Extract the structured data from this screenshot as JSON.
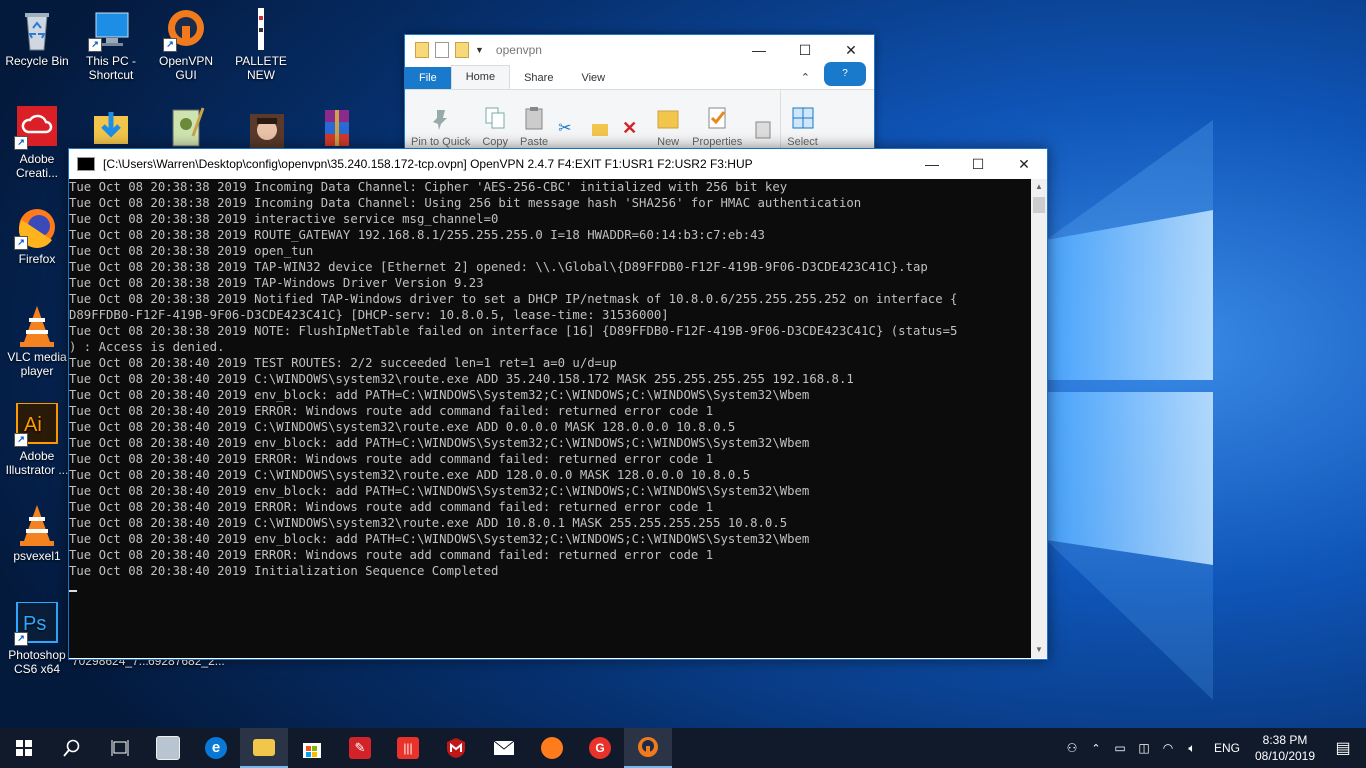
{
  "desktop": {
    "icons": [
      {
        "label": "Recycle Bin"
      },
      {
        "label": "This PC - Shortcut"
      },
      {
        "label": "OpenVPN GUI"
      },
      {
        "label": "PALLETE NEW"
      },
      {
        "label": "Adobe Creati..."
      },
      {
        "label": "Firefox"
      },
      {
        "label": "VLC media player"
      },
      {
        "label": "Adobe Illustrator ..."
      },
      {
        "label": "psvexel1"
      },
      {
        "label": "Photoshop CS6 x64"
      },
      {
        "label": "70298624_7..."
      },
      {
        "label": "69287682_2..."
      }
    ]
  },
  "explorer": {
    "title": "openvpn",
    "tabs": [
      "File",
      "Home",
      "Share",
      "View"
    ],
    "ribbon": [
      "Pin to Quick",
      "Copy",
      "Paste",
      "New",
      "Properties",
      "Select"
    ]
  },
  "console": {
    "title": "[C:\\Users\\Warren\\Desktop\\config\\openvpn\\35.240.158.172-tcp.ovpn] OpenVPN 2.4.7 F4:EXIT F1:USR1 F2:USR2 F3:HUP",
    "log": "Tue Oct 08 20:38:38 2019 Incoming Data Channel: Cipher 'AES-256-CBC' initialized with 256 bit key\nTue Oct 08 20:38:38 2019 Incoming Data Channel: Using 256 bit message hash 'SHA256' for HMAC authentication\nTue Oct 08 20:38:38 2019 interactive service msg_channel=0\nTue Oct 08 20:38:38 2019 ROUTE_GATEWAY 192.168.8.1/255.255.255.0 I=18 HWADDR=60:14:b3:c7:eb:43\nTue Oct 08 20:38:38 2019 open_tun\nTue Oct 08 20:38:38 2019 TAP-WIN32 device [Ethernet 2] opened: \\\\.\\Global\\{D89FFDB0-F12F-419B-9F06-D3CDE423C41C}.tap\nTue Oct 08 20:38:38 2019 TAP-Windows Driver Version 9.23\nTue Oct 08 20:38:38 2019 Notified TAP-Windows driver to set a DHCP IP/netmask of 10.8.0.6/255.255.255.252 on interface {\nD89FFDB0-F12F-419B-9F06-D3CDE423C41C} [DHCP-serv: 10.8.0.5, lease-time: 31536000]\nTue Oct 08 20:38:38 2019 NOTE: FlushIpNetTable failed on interface [16] {D89FFDB0-F12F-419B-9F06-D3CDE423C41C} (status=5\n) : Access is denied.\nTue Oct 08 20:38:40 2019 TEST ROUTES: 2/2 succeeded len=1 ret=1 a=0 u/d=up\nTue Oct 08 20:38:40 2019 C:\\WINDOWS\\system32\\route.exe ADD 35.240.158.172 MASK 255.255.255.255 192.168.8.1\nTue Oct 08 20:38:40 2019 env_block: add PATH=C:\\WINDOWS\\System32;C:\\WINDOWS;C:\\WINDOWS\\System32\\Wbem\nTue Oct 08 20:38:40 2019 ERROR: Windows route add command failed: returned error code 1\nTue Oct 08 20:38:40 2019 C:\\WINDOWS\\system32\\route.exe ADD 0.0.0.0 MASK 128.0.0.0 10.8.0.5\nTue Oct 08 20:38:40 2019 env_block: add PATH=C:\\WINDOWS\\System32;C:\\WINDOWS;C:\\WINDOWS\\System32\\Wbem\nTue Oct 08 20:38:40 2019 ERROR: Windows route add command failed: returned error code 1\nTue Oct 08 20:38:40 2019 C:\\WINDOWS\\system32\\route.exe ADD 128.0.0.0 MASK 128.0.0.0 10.8.0.5\nTue Oct 08 20:38:40 2019 env_block: add PATH=C:\\WINDOWS\\System32;C:\\WINDOWS;C:\\WINDOWS\\System32\\Wbem\nTue Oct 08 20:38:40 2019 ERROR: Windows route add command failed: returned error code 1\nTue Oct 08 20:38:40 2019 C:\\WINDOWS\\system32\\route.exe ADD 10.8.0.1 MASK 255.255.255.255 10.8.0.5\nTue Oct 08 20:38:40 2019 env_block: add PATH=C:\\WINDOWS\\System32;C:\\WINDOWS;C:\\WINDOWS\\System32\\Wbem\nTue Oct 08 20:38:40 2019 ERROR: Windows route add command failed: returned error code 1\nTue Oct 08 20:38:40 2019 Initialization Sequence Completed"
  },
  "taskbar": {
    "language": "ENG",
    "time": "8:38 PM",
    "date": "08/10/2019",
    "accent": "#76b9ed"
  }
}
